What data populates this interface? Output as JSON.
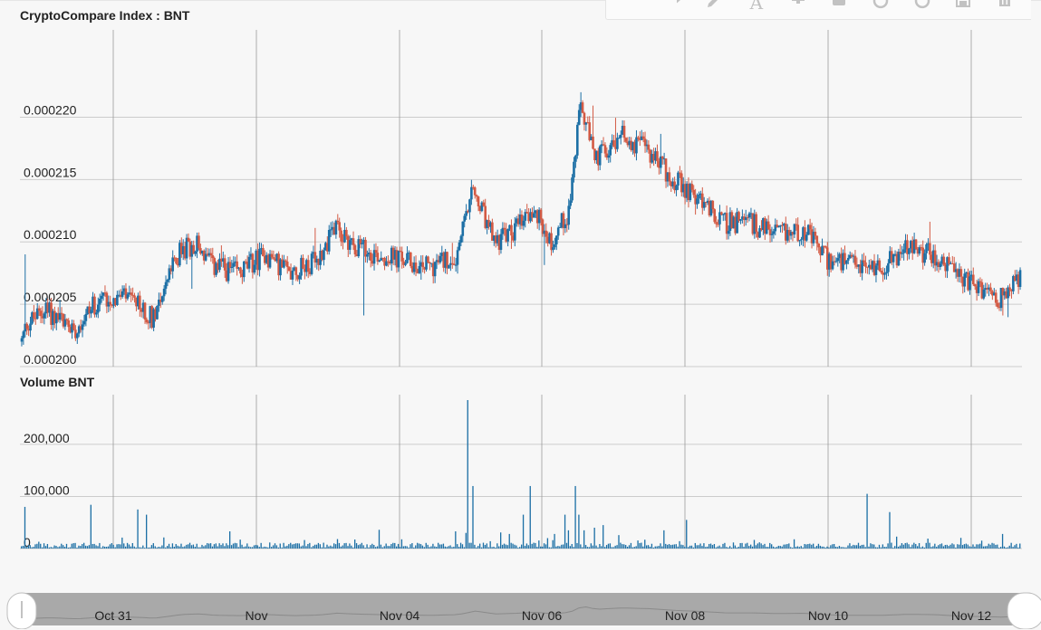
{
  "toolbar": {
    "icons": [
      "horizontal-line-icon",
      "arrow-icon",
      "pencil-icon",
      "text-icon",
      "plus-icon",
      "square-icon",
      "undo-icon",
      "redo-icon",
      "save-icon",
      "trash-icon"
    ],
    "text_tool_glyph": "A"
  },
  "colors": {
    "up": "#1c6fa5",
    "down": "#d35a44",
    "grid": "#cccccc",
    "vgrid": "#999999",
    "volume": "#1c6fa5",
    "navigator_bg": "#a9a9a9",
    "navigator_line": "#8a8a8a"
  },
  "chart_data": [
    {
      "type": "candlestick",
      "title": "CryptoCompare Index : BNT",
      "ylim": [
        0.0002,
        0.000227
      ],
      "yticks": [
        0.0002,
        0.000205,
        0.00021,
        0.000215,
        0.00022
      ],
      "ytick_labels": [
        "0.000200",
        "0.000205",
        "0.000210",
        "0.000215",
        "0.000220"
      ],
      "xticks": [
        "Oct 31",
        "Nov",
        "Nov 04",
        "Nov 06",
        "Nov 08",
        "Nov 10",
        "Nov 12"
      ],
      "grid": true,
      "waypoints": [
        {
          "i": 0,
          "v": 0.000202
        },
        {
          "i": 3,
          "v": 0.0002035
        },
        {
          "i": 14,
          "v": 0.0002045
        },
        {
          "i": 30,
          "v": 0.000203
        },
        {
          "i": 45,
          "v": 0.0002055
        },
        {
          "i": 60,
          "v": 0.0002055
        },
        {
          "i": 75,
          "v": 0.000204
        },
        {
          "i": 90,
          "v": 0.000209
        },
        {
          "i": 100,
          "v": 0.00021
        },
        {
          "i": 110,
          "v": 0.000208
        },
        {
          "i": 125,
          "v": 0.0002075
        },
        {
          "i": 140,
          "v": 0.000209
        },
        {
          "i": 155,
          "v": 0.0002075
        },
        {
          "i": 170,
          "v": 0.0002085
        },
        {
          "i": 180,
          "v": 0.000211
        },
        {
          "i": 195,
          "v": 0.0002095
        },
        {
          "i": 205,
          "v": 0.000209
        },
        {
          "i": 220,
          "v": 0.0002085
        },
        {
          "i": 235,
          "v": 0.000208
        },
        {
          "i": 250,
          "v": 0.000209
        },
        {
          "i": 260,
          "v": 0.000214
        },
        {
          "i": 272,
          "v": 0.00021
        },
        {
          "i": 285,
          "v": 0.000211
        },
        {
          "i": 295,
          "v": 0.0002125
        },
        {
          "i": 305,
          "v": 0.00021
        },
        {
          "i": 315,
          "v": 0.0002125
        },
        {
          "i": 322,
          "v": 0.000221
        },
        {
          "i": 330,
          "v": 0.0002165
        },
        {
          "i": 345,
          "v": 0.0002185
        },
        {
          "i": 360,
          "v": 0.0002175
        },
        {
          "i": 375,
          "v": 0.000215
        },
        {
          "i": 390,
          "v": 0.0002135
        },
        {
          "i": 405,
          "v": 0.0002115
        },
        {
          "i": 420,
          "v": 0.0002115
        },
        {
          "i": 435,
          "v": 0.0002105
        },
        {
          "i": 450,
          "v": 0.000211
        },
        {
          "i": 465,
          "v": 0.0002085
        },
        {
          "i": 480,
          "v": 0.000208
        },
        {
          "i": 495,
          "v": 0.000208
        },
        {
          "i": 510,
          "v": 0.0002095
        },
        {
          "i": 525,
          "v": 0.000209
        },
        {
          "i": 540,
          "v": 0.000207
        },
        {
          "i": 555,
          "v": 0.000206
        },
        {
          "i": 565,
          "v": 0.0002055
        },
        {
          "i": 575,
          "v": 0.000207
        }
      ],
      "n_candles": 576
    },
    {
      "type": "bar",
      "title": "Volume BNT",
      "ylim": [
        0,
        285000
      ],
      "yticks": [
        0,
        100000,
        200000
      ],
      "ytick_labels": [
        "0",
        "100,000",
        "200,000"
      ],
      "spikes": [
        {
          "i": 2,
          "v": 80000
        },
        {
          "i": 40,
          "v": 84000
        },
        {
          "i": 67,
          "v": 75000
        },
        {
          "i": 72,
          "v": 65000
        },
        {
          "i": 120,
          "v": 33000
        },
        {
          "i": 206,
          "v": 36000
        },
        {
          "i": 250,
          "v": 33000
        },
        {
          "i": 256,
          "v": 30000
        },
        {
          "i": 257,
          "v": 285000
        },
        {
          "i": 260,
          "v": 120000
        },
        {
          "i": 281,
          "v": 28000
        },
        {
          "i": 289,
          "v": 65000
        },
        {
          "i": 293,
          "v": 120000
        },
        {
          "i": 303,
          "v": 20000
        },
        {
          "i": 307,
          "v": 28000
        },
        {
          "i": 313,
          "v": 65000
        },
        {
          "i": 315,
          "v": 35000
        },
        {
          "i": 319,
          "v": 120000
        },
        {
          "i": 321,
          "v": 65000
        },
        {
          "i": 324,
          "v": 35000
        },
        {
          "i": 330,
          "v": 40000
        },
        {
          "i": 335,
          "v": 45000
        },
        {
          "i": 370,
          "v": 35000
        },
        {
          "i": 383,
          "v": 55000
        },
        {
          "i": 487,
          "v": 105000
        },
        {
          "i": 500,
          "v": 70000
        },
        {
          "i": 565,
          "v": 28000
        }
      ],
      "base_level": 8000,
      "n_bars": 576
    },
    {
      "type": "area",
      "role": "navigator",
      "xticks": [
        "Oct 31",
        "Nov",
        "Nov 04",
        "Nov 06",
        "Nov 08",
        "Nov 10",
        "Nov 12"
      ]
    }
  ]
}
